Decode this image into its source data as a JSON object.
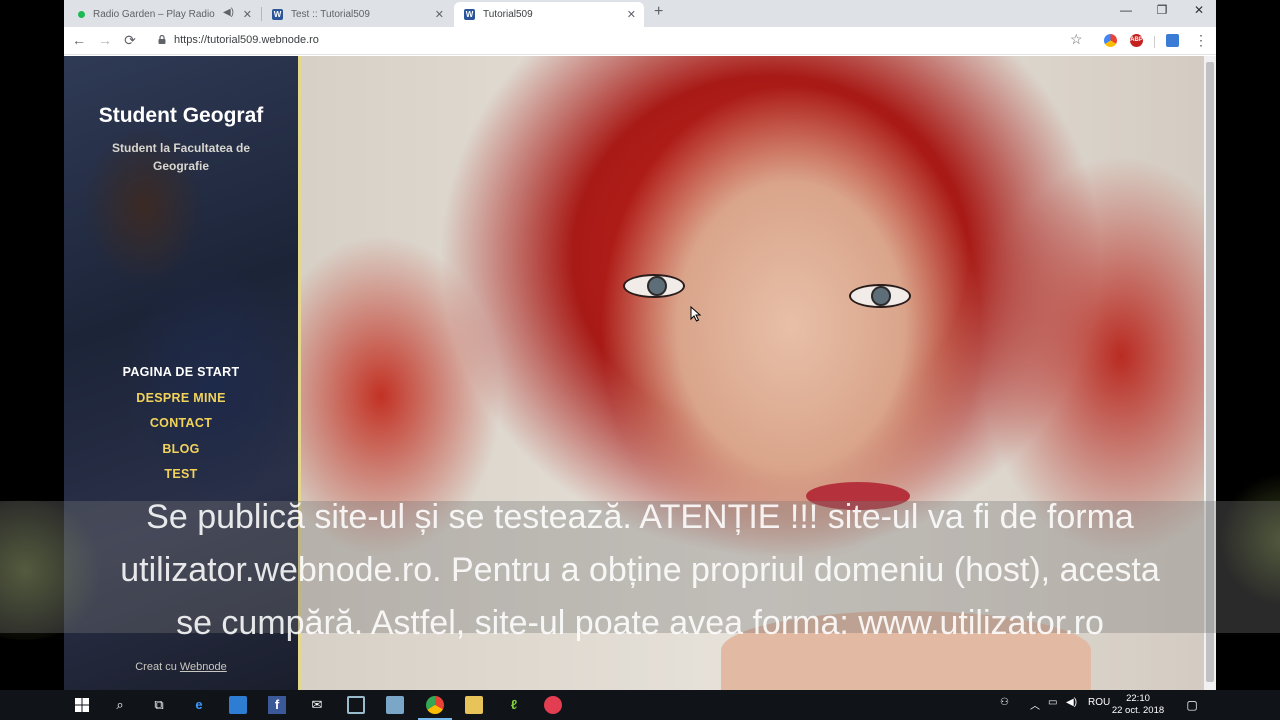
{
  "browser": {
    "tabs": [
      {
        "title": "Radio Garden – Play Radio",
        "close": "✕",
        "audio_icon": "speaker-icon",
        "favicon_color": "#1db954"
      },
      {
        "title": "Test :: Tutorial509",
        "close": "✕",
        "favicon_color": "#2b579a",
        "favicon_letter": "W"
      },
      {
        "title": "Tutorial509",
        "close": "✕",
        "favicon_color": "#2b579a",
        "favicon_letter": "W"
      }
    ],
    "new_tab": "+",
    "window_controls": {
      "minimize": "—",
      "maximize": "❐",
      "close": "✕"
    },
    "url": "https://tutorial509.webnode.ro",
    "extensions": {
      "abp": "ABP"
    }
  },
  "site": {
    "title": "Student Geograf",
    "subtitle": "Student la Facultatea de Geografie",
    "menu": [
      {
        "label": "PAGINA DE START",
        "current": true
      },
      {
        "label": "DESPRE MINE",
        "current": false
      },
      {
        "label": "CONTACT",
        "current": false
      },
      {
        "label": "BLOG",
        "current": false
      },
      {
        "label": "TEST",
        "current": false
      }
    ],
    "credit_prefix": "Creat cu",
    "credit_link": "Webnode",
    "accent_color": "#f2d35a"
  },
  "caption": {
    "lines": [
      "Se publică site-ul și se testează. ATENȚIE !!! site-ul va fi de forma",
      "utilizator.webnode.ro. Pentru a obține propriul domeniu (host), acesta",
      "se cumpără. Astfel, site-ul poate avea forma: www.utilizator.ro"
    ]
  },
  "taskbar": {
    "language": "ROU",
    "time": "22:10",
    "date": "22 oct. 2018"
  }
}
